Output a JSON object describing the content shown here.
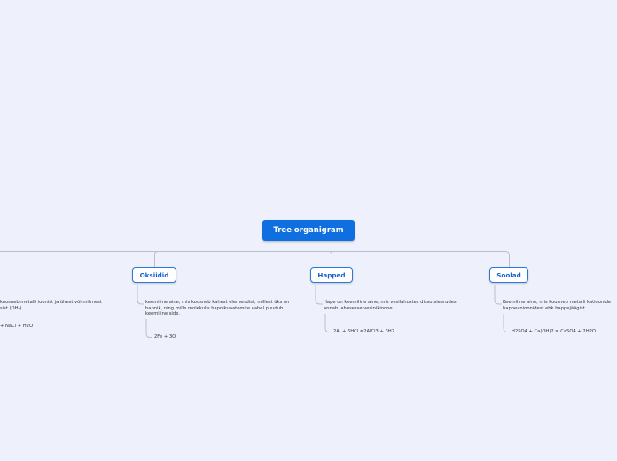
{
  "root": {
    "title": "Tree organigram"
  },
  "branches": [
    {
      "label": "",
      "description": [
        "koosneb metalli ioonist ja ühest või mitmest",
        "sist (OH-)"
      ],
      "equation": "+ NaCl + H2O"
    },
    {
      "label": "Oksiidid",
      "description": [
        "keemiline aine, mis koosneb kahest elemendist, millest üks on",
        "hapnik, ning mille molekulis hapnikuaatomite vahel puudub",
        "keemiline side."
      ],
      "equation": "2Fe + 3O"
    },
    {
      "label": "Happed",
      "description": [
        "Hape on keemiline aine, mis vesilahustes dissotsieerudes",
        "annab lahusesse vesinikioone."
      ],
      "equation": "2Al + 6HCl =2AlCl3  + 3H2"
    },
    {
      "label": "Soolad",
      "description": [
        "Keemiline aine, mis koosneb metalli katioonide",
        "happeanioonidest ehk happejäägist."
      ],
      "equation": "H2SO4 + Ca(OH)2 = CaSO4 + 2H2O"
    }
  ],
  "colors": {
    "background": "#eef1fb",
    "root_fill": "#0f6fe0",
    "topic_border": "#2a78d8",
    "topic_text": "#1a63c6",
    "connector": "#b9bfcc"
  }
}
